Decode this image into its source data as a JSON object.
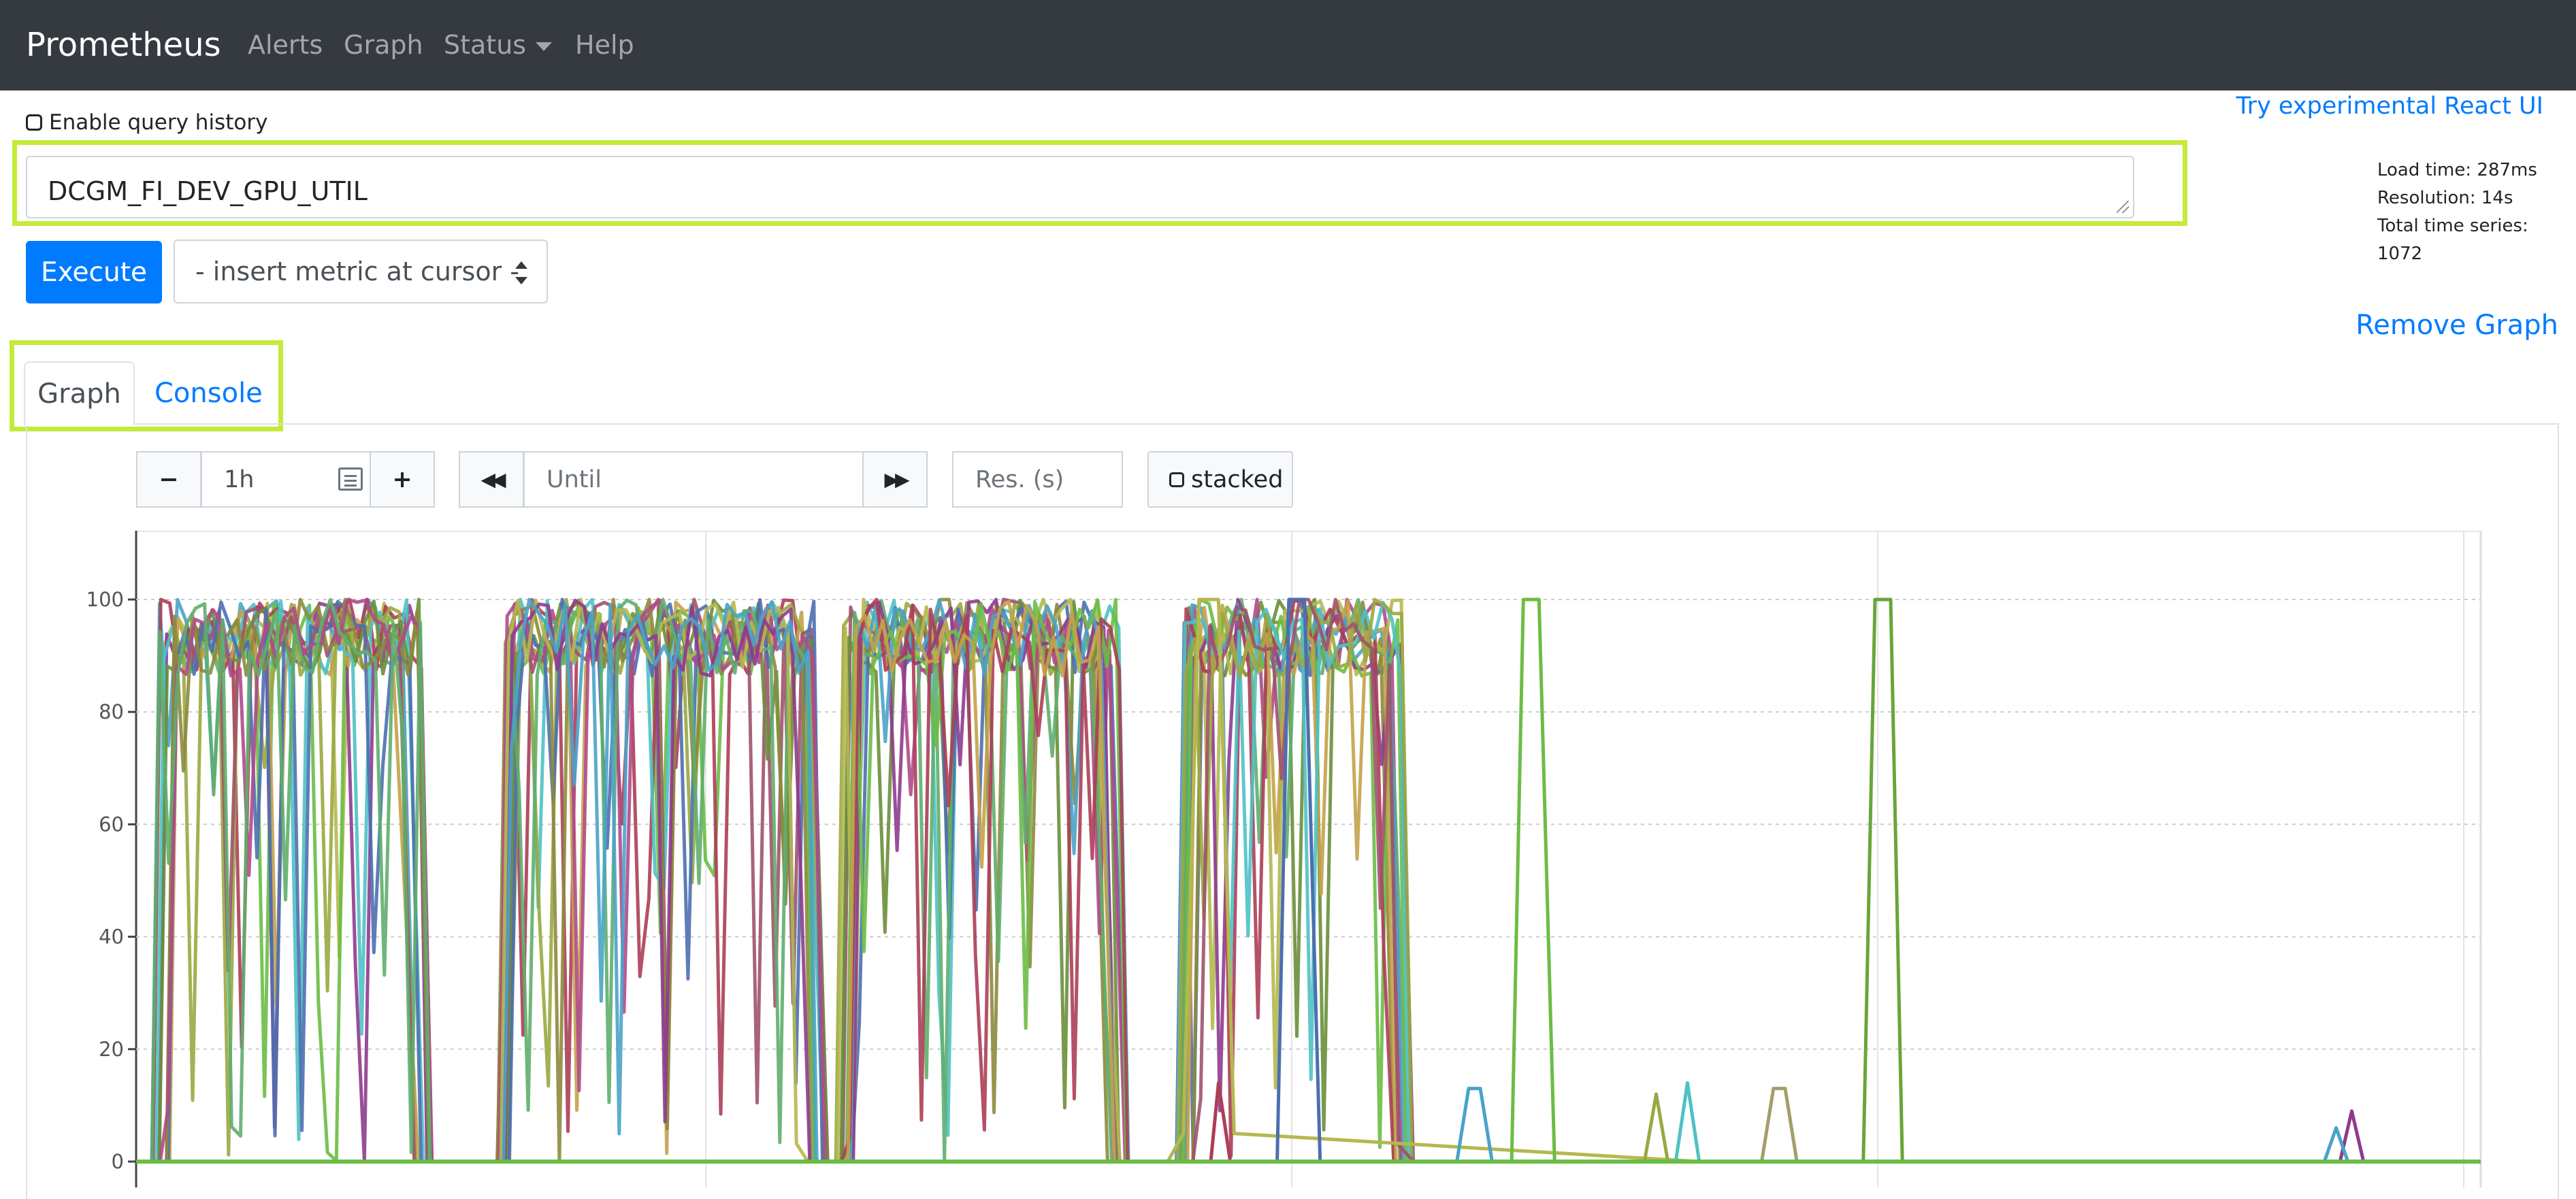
{
  "navbar": {
    "brand": "Prometheus",
    "items": [
      "Alerts",
      "Graph",
      "Status",
      "Help"
    ]
  },
  "query_history": {
    "label": "Enable query history",
    "checked": false
  },
  "react_link": "Try experimental React UI",
  "expression": {
    "value": "DCGM_FI_DEV_GPU_UTIL"
  },
  "stats": {
    "load_time": "Load time: 287ms",
    "resolution": "Resolution: 14s",
    "total_series": "Total time series: 1072"
  },
  "execute_label": "Execute",
  "metric_select": {
    "selected": "- insert metric at cursor -"
  },
  "remove_graph": "Remove Graph",
  "tabs": [
    {
      "label": "Graph",
      "active": true
    },
    {
      "label": "Console",
      "active": false
    }
  ],
  "graph_controls": {
    "minus": "−",
    "range": "1h",
    "plus": "+",
    "back": "◀◀",
    "until_placeholder": "Until",
    "forward": "▶▶",
    "res_placeholder": "Res. (s)",
    "stacked_label": "stacked"
  },
  "colors": {
    "accent": "#007bff",
    "navbar": "#343a40",
    "highlight": "#c5ea3a"
  },
  "chart_data": {
    "type": "line",
    "title": "",
    "xlabel": "",
    "ylabel": "",
    "ylim": [
      0,
      110
    ],
    "yticks": [
      0,
      20,
      40,
      60,
      80,
      100
    ],
    "x_unit": "minutes",
    "xlim": [
      0,
      60
    ],
    "grid": true,
    "busy_periods": [
      {
        "start": 0.6,
        "end": 7.5,
        "level": 92
      },
      {
        "start": 9.4,
        "end": 17.5,
        "level": 92
      },
      {
        "start": 18.1,
        "end": 25.2,
        "level": 92
      },
      {
        "start": 26.8,
        "end": 32.5,
        "level": 92
      }
    ],
    "series_samples": [
      {
        "color": "#b5b84f",
        "x": [
          0,
          26.4,
          26.8,
          27.2,
          27.7,
          28.1,
          40,
          60
        ],
        "y": [
          0,
          0,
          5,
          100,
          100,
          5,
          0,
          0
        ]
      },
      {
        "color": "#4c6fb0",
        "x": [
          0,
          29.2,
          29.5,
          29.9,
          30.3,
          60
        ],
        "y": [
          0,
          0,
          100,
          100,
          0,
          0
        ]
      },
      {
        "color": "#6abd45",
        "x": [
          0,
          35.2,
          35.5,
          35.9,
          36.3,
          60
        ],
        "y": [
          0,
          0,
          100,
          100,
          0,
          0
        ]
      },
      {
        "color": "#67a63a",
        "x": [
          0,
          44.2,
          44.5,
          44.9,
          45.2,
          60
        ],
        "y": [
          0,
          0,
          100,
          100,
          0,
          0
        ]
      },
      {
        "color": "#ac3e57",
        "x": [
          0,
          27.5,
          27.7,
          28,
          60
        ],
        "y": [
          0,
          0,
          14,
          0,
          0
        ]
      },
      {
        "color": "#4aa3c9",
        "x": [
          0,
          33.8,
          34.1,
          34.4,
          34.7,
          60
        ],
        "y": [
          0,
          0,
          13,
          13,
          0,
          0
        ]
      },
      {
        "color": "#9aa841",
        "x": [
          0,
          38.6,
          38.9,
          39.2,
          60
        ],
        "y": [
          0,
          0,
          12,
          0,
          0
        ]
      },
      {
        "color": "#4fc1c4",
        "x": [
          0,
          39.4,
          39.7,
          40,
          60
        ],
        "y": [
          0,
          0,
          14,
          0,
          0
        ]
      },
      {
        "color": "#a29f6a",
        "x": [
          0,
          41.6,
          41.9,
          42.2,
          42.5,
          60
        ],
        "y": [
          0,
          0,
          13,
          13,
          0,
          0
        ]
      },
      {
        "color": "#8e3b8f",
        "x": [
          0,
          56.4,
          56.7,
          57,
          60
        ],
        "y": [
          0,
          0,
          9,
          0,
          0
        ]
      },
      {
        "color": "#4aa3c9",
        "x": [
          0,
          56,
          56.3,
          56.6,
          60
        ],
        "y": [
          0,
          0,
          6,
          0,
          0
        ]
      }
    ]
  }
}
